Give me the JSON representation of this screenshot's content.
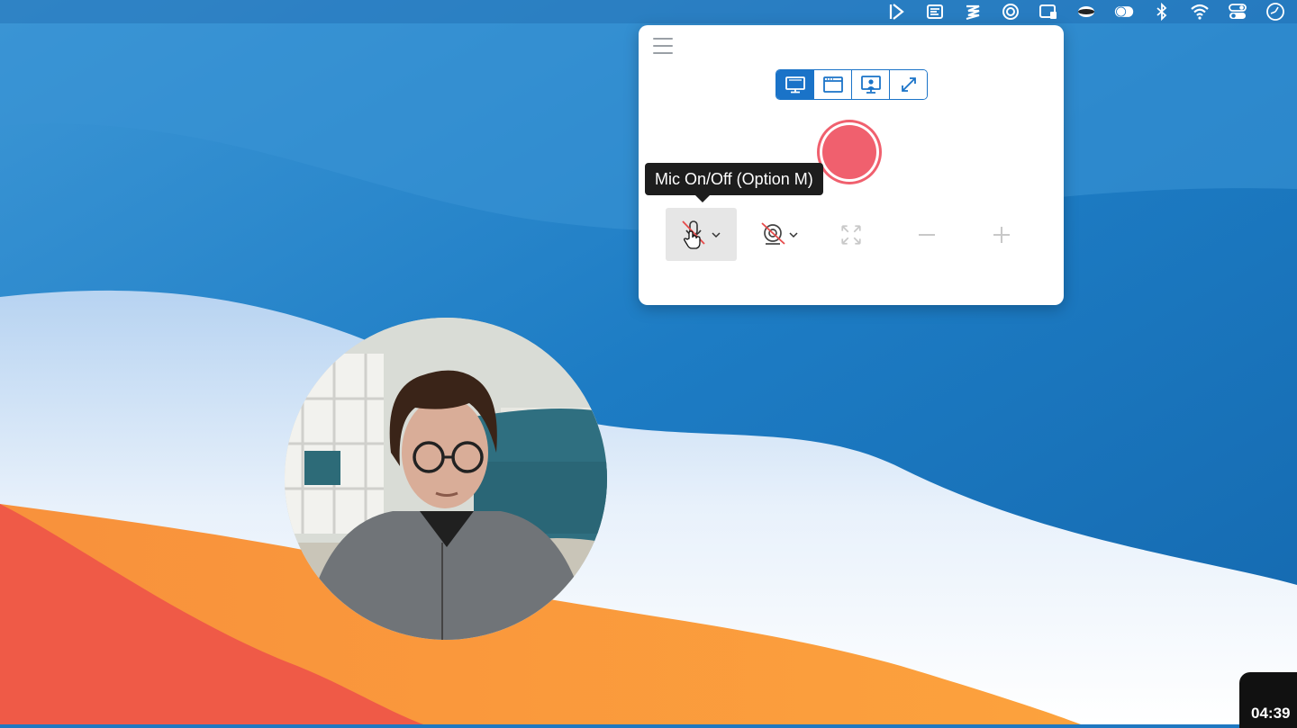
{
  "menubar": {
    "icons": [
      "screencast-icon",
      "text-list-icon",
      "stripes-icon",
      "layers-icon",
      "screenshot-icon",
      "eyes-icon",
      "toggle-icon",
      "bluetooth-icon",
      "wifi-icon",
      "control-center-icon",
      "clock-icon"
    ]
  },
  "recorder": {
    "modes": [
      "screen-mode",
      "window-mode",
      "screen-and-camera-mode",
      "fullscreen-mode"
    ],
    "active_mode": "screen-mode",
    "tooltip": "Mic On/Off (Option M)",
    "mic_state": "off",
    "camera_state": "off",
    "accent_color": "#1a73c8",
    "record_color": "#f0606e"
  },
  "timer": {
    "elapsed": "04:39"
  }
}
